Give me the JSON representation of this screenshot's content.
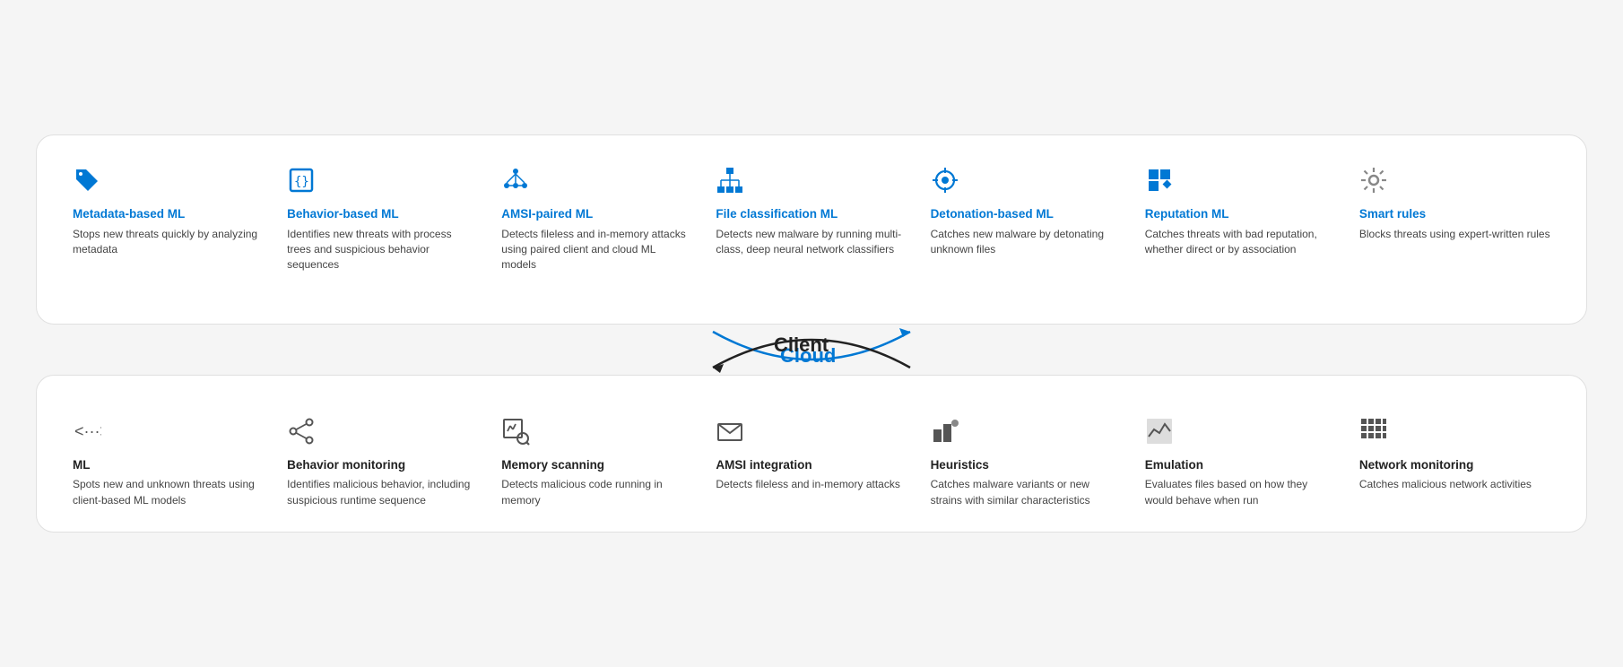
{
  "cloud": {
    "label": "Cloud",
    "items": [
      {
        "icon": "tag",
        "title": "Metadata-based ML",
        "desc": "Stops new threats quickly by analyzing metadata"
      },
      {
        "icon": "code",
        "title": "Behavior-based ML",
        "desc": "Identifies new threats with process trees and suspicious behavior sequences"
      },
      {
        "icon": "network",
        "title": "AMSI-paired ML",
        "desc": "Detects fileless and in-memory attacks using paired client and cloud ML models"
      },
      {
        "icon": "hierarchy",
        "title": "File classification ML",
        "desc": "Detects new malware by running multi-class, deep neural network classifiers"
      },
      {
        "icon": "crosshair",
        "title": "Detonation-based ML",
        "desc": "Catches new malware by detonating unknown files"
      },
      {
        "icon": "reputation",
        "title": "Reputation ML",
        "desc": "Catches threats with bad reputation, whether direct or by association"
      },
      {
        "icon": "gear",
        "title": "Smart rules",
        "desc": "Blocks threats using expert-written rules"
      }
    ]
  },
  "client": {
    "label": "Client",
    "items": [
      {
        "icon": "arrows",
        "title": "ML",
        "desc": "Spots new and unknown threats using client-based ML models"
      },
      {
        "icon": "share",
        "title": "Behavior monitoring",
        "desc": "Identifies malicious behavior, including suspicious runtime sequence"
      },
      {
        "icon": "scanChart",
        "title": "Memory scanning",
        "desc": "Detects malicious code running in memory"
      },
      {
        "icon": "envelope",
        "title": "AMSI integration",
        "desc": "Detects fileless and in-memory attacks"
      },
      {
        "icon": "heuristics",
        "title": "Heuristics",
        "desc": "Catches malware variants or new strains with similar characteristics"
      },
      {
        "icon": "emulation",
        "title": "Emulation",
        "desc": "Evaluates files based on how they would behave when run"
      },
      {
        "icon": "network-mon",
        "title": "Network monitoring",
        "desc": "Catches malicious network activities"
      }
    ]
  }
}
